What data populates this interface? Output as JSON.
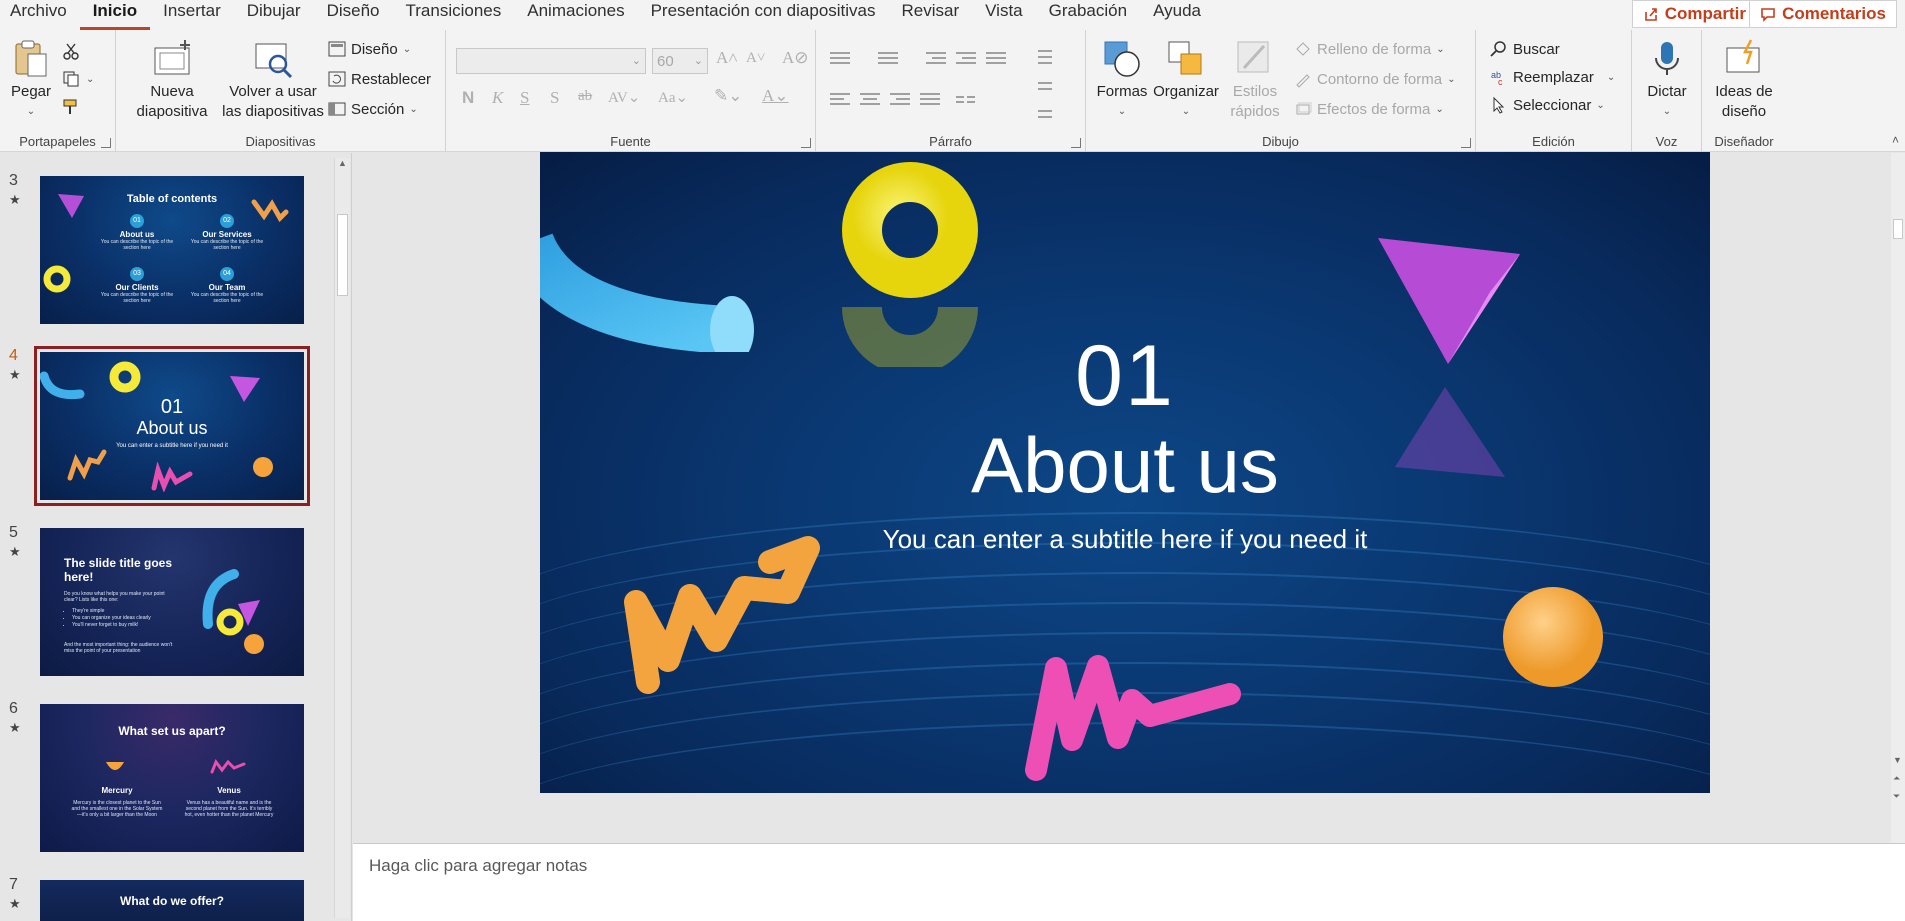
{
  "menu": {
    "tabs": [
      "Archivo",
      "Inicio",
      "Insertar",
      "Dibujar",
      "Diseño",
      "Transiciones",
      "Animaciones",
      "Presentación con diapositivas",
      "Revisar",
      "Vista",
      "Grabación",
      "Ayuda"
    ],
    "active": "Inicio",
    "share": "Compartir",
    "comments": "Comentarios"
  },
  "ribbon": {
    "clipboard": {
      "label": "Portapapeles",
      "paste": "Pegar"
    },
    "slides": {
      "label": "Diapositivas",
      "new_slide": "Nueva diapositiva",
      "reuse": "Volver a usar las diapositivas",
      "layout": "Diseño",
      "reset": "Restablecer",
      "section": "Sección"
    },
    "font": {
      "label": "Fuente",
      "size": "60"
    },
    "paragraph": {
      "label": "Párrafo"
    },
    "drawing": {
      "label": "Dibujo",
      "shapes": "Formas",
      "arrange": "Organizar",
      "quick_styles": "Estilos rápidos",
      "fill": "Relleno de forma",
      "outline": "Contorno de forma",
      "effects": "Efectos de forma"
    },
    "editing": {
      "label": "Edición",
      "find": "Buscar",
      "replace": "Reemplazar",
      "select": "Seleccionar"
    },
    "voice": {
      "label": "Voz",
      "dictate": "Dictar"
    },
    "designer": {
      "label": "Diseñador",
      "design_ideas": "Ideas de diseño"
    }
  },
  "thumbnails": [
    {
      "num": "3",
      "title": "Table of contents",
      "items": [
        {
          "n": "01",
          "h": "About us",
          "d": "You can describe the topic of the section here"
        },
        {
          "n": "02",
          "h": "Our Services",
          "d": "You can describe the topic of the section here"
        },
        {
          "n": "03",
          "h": "Our Clients",
          "d": "You can describe the topic of the section here"
        },
        {
          "n": "04",
          "h": "Our Team",
          "d": "You can describe the topic of the section here"
        }
      ]
    },
    {
      "num": "4",
      "num_big": "01",
      "title": "About us",
      "sub": "You can enter a subtitle here if you need it",
      "selected": true
    },
    {
      "num": "5",
      "title": "The slide title goes here!",
      "body": "Do you know what helps you make your point clear? Lists like this one:",
      "bullets": [
        "They're simple",
        "You can organize your ideas clearly",
        "You'll never forget to buy milk!"
      ],
      "footer": "And the most important thing: the audience won't miss the point of your presentation"
    },
    {
      "num": "6",
      "title": "What set us apart?",
      "cols": [
        {
          "h": "Mercury",
          "d": "Mercury is the closest planet to the Sun and the smallest one in the Solar System—it's only a bit larger than the Moon"
        },
        {
          "h": "Venus",
          "d": "Venus has a beautiful name and is the second planet from the Sun. It's terribly hot, even hotter than the planet Mercury"
        }
      ]
    },
    {
      "num": "7",
      "title": "What do we offer?"
    }
  ],
  "slide": {
    "number": "01",
    "title": "About us",
    "subtitle": "You can enter a subtitle here if you need it"
  },
  "notes": {
    "placeholder": "Haga clic para agregar notas"
  },
  "colors": {
    "accent": "#b7472a",
    "share": "#c43e1c",
    "slide_bg": "#0a3872"
  }
}
